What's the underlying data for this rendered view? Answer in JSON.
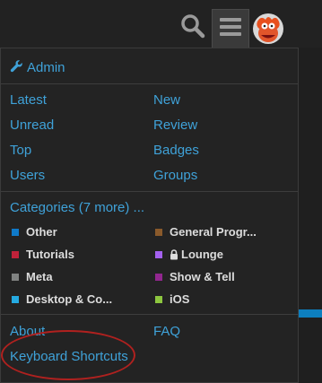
{
  "header": {
    "search_icon": "search-icon",
    "menu_icon": "hamburger-menu-icon",
    "avatar": "user-avatar"
  },
  "menu": {
    "admin_label": "Admin",
    "links_left": [
      "Latest",
      "Unread",
      "Top",
      "Users"
    ],
    "links_right": [
      "New",
      "Review",
      "Badges",
      "Groups"
    ],
    "categories_header": "Categories (7 more) ...",
    "categories": [
      {
        "name": "Other",
        "color": "#0f7ac9",
        "locked": false
      },
      {
        "name": "General Progr...",
        "color": "#8a5a2b",
        "locked": false
      },
      {
        "name": "Tutorials",
        "color": "#c0223a",
        "locked": false
      },
      {
        "name": "Lounge",
        "color": "#a461ef",
        "locked": true
      },
      {
        "name": "Meta",
        "color": "#808281",
        "locked": false
      },
      {
        "name": "Show & Tell",
        "color": "#92278f",
        "locked": false
      },
      {
        "name": "Desktop & Co...",
        "color": "#25aae1",
        "locked": false
      },
      {
        "name": "iOS",
        "color": "#8dc63f",
        "locked": false
      }
    ],
    "footer_left": [
      "About",
      "Keyboard Shortcuts"
    ],
    "footer_right": [
      "FAQ"
    ]
  },
  "colors": {
    "link": "#3fa2d9",
    "highlight_oval": "#b0211f"
  }
}
